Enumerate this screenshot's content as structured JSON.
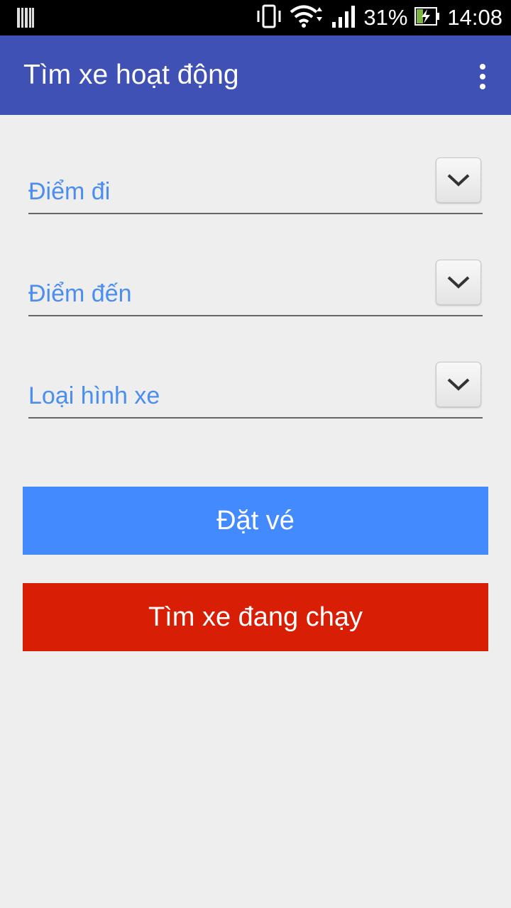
{
  "status_bar": {
    "battery_percent": "31%",
    "time": "14:08",
    "icons": [
      "barcode-icon",
      "vibrate-icon",
      "wifi-icon",
      "signal-icon",
      "battery-charging-icon"
    ]
  },
  "app_bar": {
    "title": "Tìm xe hoạt động",
    "menu_icon": "overflow-menu-icon"
  },
  "form": {
    "fields": [
      {
        "label": "Điểm đi",
        "icon": "chevron-down-icon"
      },
      {
        "label": "Điểm đến",
        "icon": "chevron-down-icon"
      },
      {
        "label": "Loại hình xe",
        "icon": "chevron-down-icon"
      }
    ]
  },
  "buttons": {
    "book_label": "Đặt vé",
    "track_label": "Tìm xe đang chạy"
  },
  "colors": {
    "app_bar": "#3f51b5",
    "label": "#4a8ef0",
    "book_button": "#448aff",
    "track_button": "#d81e05",
    "background": "#eeeeee"
  }
}
